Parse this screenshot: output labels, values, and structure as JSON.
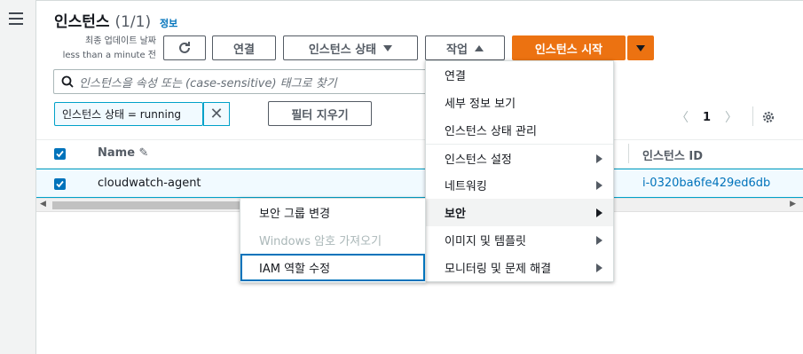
{
  "header": {
    "title": "인스턴스",
    "count": "(1/1)",
    "info_link": "정보",
    "last_update_line1": "최종 업데이트 날짜",
    "last_update_line2": "less than a minute 전"
  },
  "toolbar": {
    "connect": "연결",
    "instance_state": "인스턴스 상태",
    "actions": "작업",
    "launch": "인스턴스 시작"
  },
  "search": {
    "placeholder": "인스턴스을 속성 또는 (case-sensitive) 태그로 찾기"
  },
  "filter": {
    "token": "인스턴스 상태 = running",
    "clear": "필터 지우기"
  },
  "pagination": {
    "page": "1"
  },
  "table": {
    "columns": [
      "Name",
      "인스턴스 ID"
    ],
    "rows": [
      {
        "name": "cloudwatch-agent",
        "instance_id": "i-0320ba6fe429ed6db",
        "selected": true
      }
    ]
  },
  "actions_menu": {
    "items": [
      {
        "label": "연결",
        "submenu": false
      },
      {
        "label": "세부 정보 보기",
        "submenu": false
      },
      {
        "label": "인스턴스 상태 관리",
        "submenu": false
      },
      {
        "label": "인스턴스 설정",
        "submenu": true
      },
      {
        "label": "네트워킹",
        "submenu": true
      },
      {
        "label": "보안",
        "submenu": true,
        "active": true
      },
      {
        "label": "이미지 및 템플릿",
        "submenu": true
      },
      {
        "label": "모니터링 및 문제 해결",
        "submenu": true
      }
    ]
  },
  "security_submenu": {
    "items": [
      {
        "label": "보안 그룹 변경",
        "disabled": false
      },
      {
        "label": "Windows 암호 가져오기",
        "disabled": true
      },
      {
        "label": "IAM 역할 수정",
        "disabled": false,
        "focused": true
      }
    ]
  },
  "colors": {
    "primary": "#ec7211",
    "accent": "#0073bb",
    "selected_row": "#f1faff"
  }
}
